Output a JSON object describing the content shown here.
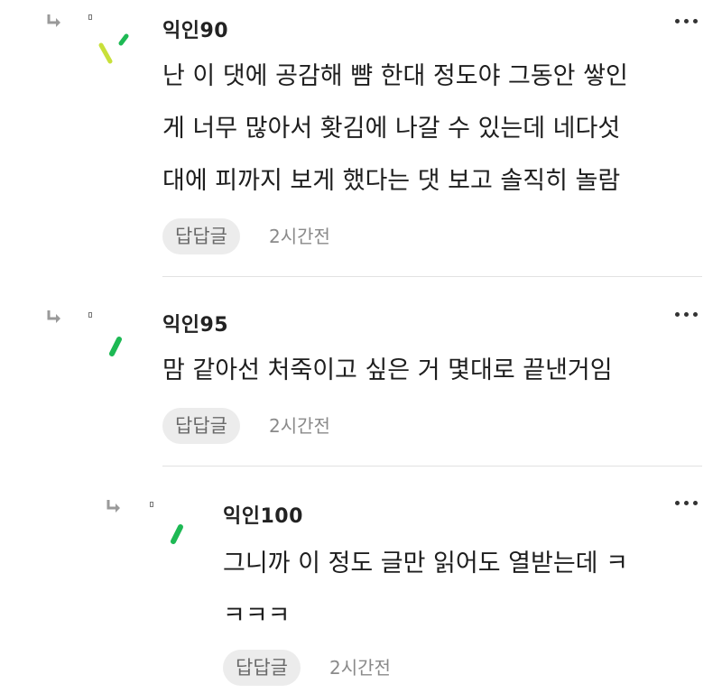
{
  "comments": [
    {
      "nickname": "익인90",
      "text": "난 이 댓에 공감해 뺨 한대 정도야 그동안 쌓인\n게 너무 많아서 홧김에 나갈 수 있는데 네다섯\n대에 피까지 보게 했다는 댓 보고 솔직히 놀람",
      "reply_label": "답답글",
      "time": "2시간전"
    },
    {
      "nickname": "익인95",
      "text": "맘 같아선 처죽이고 싶은 거 몇대로 끝낸거임",
      "reply_label": "답답글",
      "time": "2시간전"
    },
    {
      "nickname": "익인100",
      "text": "그니까 이 정도 글만 읽어도 열받는데 ㅋ\nㅋㅋㅋ",
      "reply_label": "답답글",
      "time": "2시간전"
    }
  ],
  "colors": {
    "accent_green": "#1db954",
    "accent_lime": "#c8e03a",
    "button_bg": "#ececec",
    "divider": "#e2e2e2"
  },
  "icons": {
    "reply_arrow": "reply-arrow-icon",
    "more": "more-dots-icon",
    "anon": "anonymous-avatar-icon"
  }
}
